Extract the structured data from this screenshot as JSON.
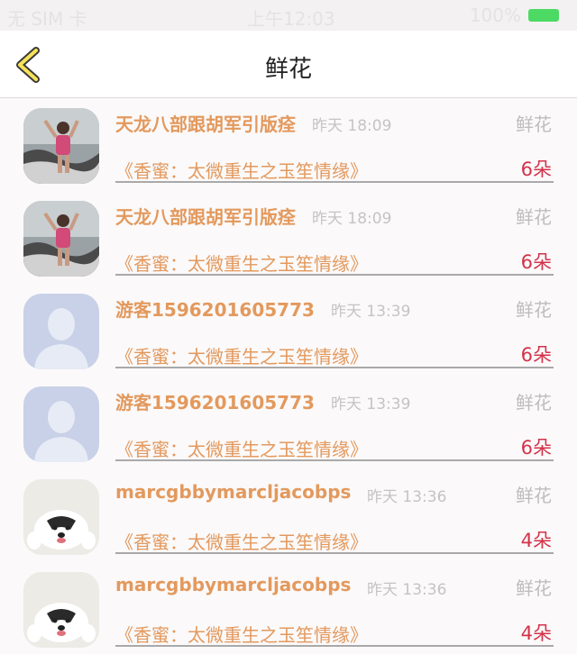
{
  "statusbar": {
    "carrier": "无 SIM 卡",
    "time": "上午12:03",
    "battery": "100%"
  },
  "nav": {
    "title": "鲜花"
  },
  "colors": {
    "accent": "#e3995d",
    "count": "#d3334a",
    "battery": "#4cd964",
    "back": "#f7e35a"
  },
  "items": [
    {
      "name": "天龙八部跟胡军引版痊",
      "time": "昨天 18:09",
      "gift": "鲜花",
      "book": "《香蜜：太微重生之玉笙情缘》",
      "count": "6朵",
      "avatar": "photo-avatar-icon"
    },
    {
      "name": "天龙八部跟胡军引版痊",
      "time": "昨天 18:09",
      "gift": "鲜花",
      "book": "《香蜜：太微重生之玉笙情缘》",
      "count": "6朵",
      "avatar": "photo-avatar-icon"
    },
    {
      "name": "游客1596201605773",
      "time": "昨天 13:39",
      "gift": "鲜花",
      "book": "《香蜜：太微重生之玉笙情缘》",
      "count": "6朵",
      "avatar": "default-user-icon"
    },
    {
      "name": "游客1596201605773",
      "time": "昨天 13:39",
      "gift": "鲜花",
      "book": "《香蜜：太微重生之玉笙情缘》",
      "count": "6朵",
      "avatar": "default-user-icon"
    },
    {
      "name": "marcgbbymarcljacobps",
      "time": "昨天 13:36",
      "gift": "鲜花",
      "book": "《香蜜：太微重生之玉笙情缘》",
      "count": "4朵",
      "avatar": "dog-avatar-icon"
    },
    {
      "name": "marcgbbymarcljacobps",
      "time": "昨天 13:36",
      "gift": "鲜花",
      "book": "《香蜜：太微重生之玉笙情缘》",
      "count": "4朵",
      "avatar": "dog-avatar-icon"
    }
  ]
}
